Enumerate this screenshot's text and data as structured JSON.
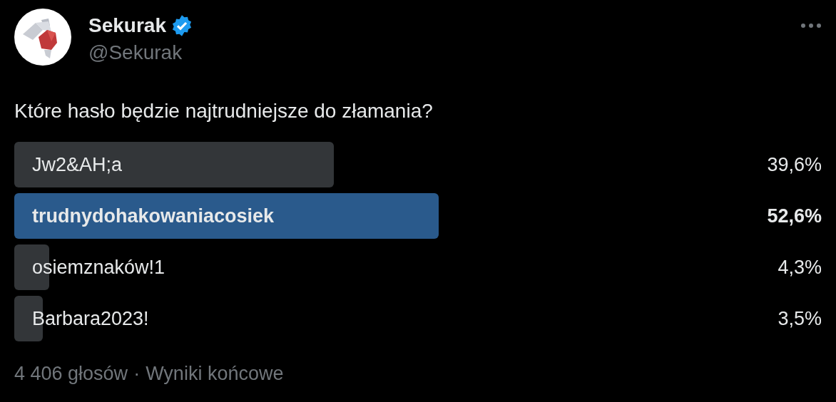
{
  "author": {
    "name": "Sekurak",
    "verified": true,
    "handle": "@Sekurak"
  },
  "question": "Które hasło będzie najtrudniejsze do złamania?",
  "poll": {
    "options": [
      {
        "label": "Jw2&AH;a",
        "percent": "39,6%",
        "winner": false
      },
      {
        "label": "trudnydohakowaniacosiek",
        "percent": "52,6%",
        "winner": true
      },
      {
        "label": "osiemznaków!1",
        "percent": "4,3%",
        "winner": false
      },
      {
        "label": "Barbara2023!",
        "percent": "3,5%",
        "winner": false
      }
    ],
    "votes": "4 406 głosów",
    "separator": "·",
    "status": "Wyniki końcowe"
  }
}
